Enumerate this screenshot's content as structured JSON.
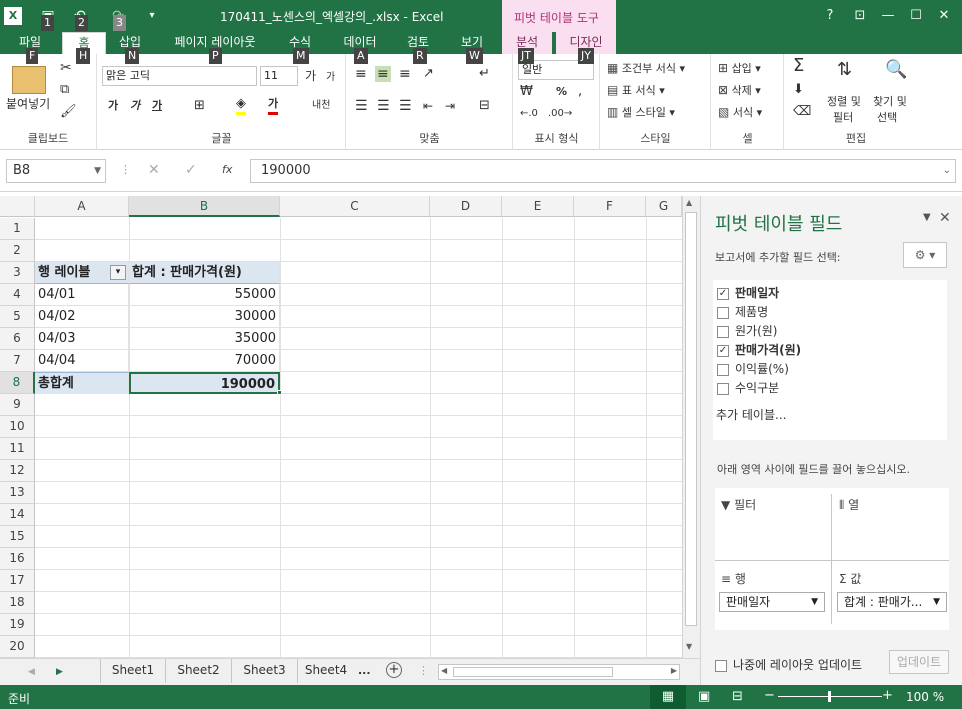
{
  "window": {
    "title": "170411_노센스의_엑셀강의_.xlsx - Excel",
    "context_tab": "피벗 테이블 도구",
    "help": "?"
  },
  "keytips": {
    "qat1": "1",
    "qat2": "2",
    "qat3": "3",
    "file": "F",
    "home": "H",
    "insert": "N",
    "page": "P",
    "formulas": "M",
    "data": "A",
    "review": "R",
    "view": "W",
    "analyze": "JT",
    "design": "JY"
  },
  "tabs": [
    "파일",
    "홈",
    "삽입",
    "페이지 레이아웃",
    "수식",
    "데이터",
    "검토",
    "보기",
    "분석",
    "디자인"
  ],
  "ribbon": {
    "clipboard": {
      "label": "클립보드",
      "paste": "붙여넣기"
    },
    "font": {
      "label": "글꼴",
      "name": "맑은 고딕",
      "size": "11",
      "bold": "가",
      "italic": "가",
      "underline": "가",
      "grow": "가",
      "shrink": "가",
      "color": "가",
      "phonetic": "내천"
    },
    "align": {
      "label": "맞춤"
    },
    "number": {
      "label": "표시 형식",
      "format": "일반",
      "percent": "%"
    },
    "styles": {
      "label": "스타일",
      "cond": "조건부 서식",
      "table": "표 서식",
      "cell": "셀 스타일"
    },
    "cells": {
      "label": "셀",
      "insert": "삽입",
      "delete": "삭제",
      "format": "서식"
    },
    "edit": {
      "label": "편집",
      "sort1": "정렬 및",
      "sort2": "필터",
      "find1": "찾기 및",
      "find2": "선택"
    }
  },
  "formula_bar": {
    "name_box": "B8",
    "fx": "fx",
    "value": "190000"
  },
  "columns": [
    "A",
    "B",
    "C",
    "D",
    "E",
    "F",
    "G"
  ],
  "rows": [
    "1",
    "2",
    "3",
    "4",
    "5",
    "6",
    "7",
    "8",
    "9",
    "10",
    "11",
    "12",
    "13",
    "14",
    "15",
    "16",
    "17",
    "18",
    "19",
    "20"
  ],
  "pivot": {
    "row_label": "행 레이블",
    "sum_label": "합계 : 판매가격(원)",
    "rows": [
      {
        "date": "04/01",
        "value": "55000"
      },
      {
        "date": "04/02",
        "value": "30000"
      },
      {
        "date": "04/03",
        "value": "35000"
      },
      {
        "date": "04/04",
        "value": "70000"
      }
    ],
    "total_label": "총합계",
    "total_value": "190000"
  },
  "sheets": [
    "Sheet1",
    "Sheet2",
    "Sheet3",
    "Sheet4"
  ],
  "sheets_more": "...",
  "status": {
    "ready": "준비",
    "zoom": "100 %"
  },
  "pane": {
    "title": "피벗 테이블 필드",
    "subtitle": "보고서에 추가할 필드 선택:",
    "fields": [
      {
        "name": "판매일자",
        "checked": true
      },
      {
        "name": "제품명",
        "checked": false
      },
      {
        "name": "원가(원)",
        "checked": false
      },
      {
        "name": "판매가격(원)",
        "checked": true
      },
      {
        "name": "이익률(%)",
        "checked": false
      },
      {
        "name": "수익구분",
        "checked": false
      }
    ],
    "more_tables": "추가 테이블...",
    "drag_hint": "아래 영역 사이에 필드를 끌어 놓으십시오.",
    "filter": "필터",
    "columns": "열",
    "rows": "행",
    "values": "값",
    "rows_item": "판매일자",
    "values_item": "합계 : 판매가...",
    "defer": "나중에 레이아웃 업데이트",
    "update": "업데이트"
  }
}
